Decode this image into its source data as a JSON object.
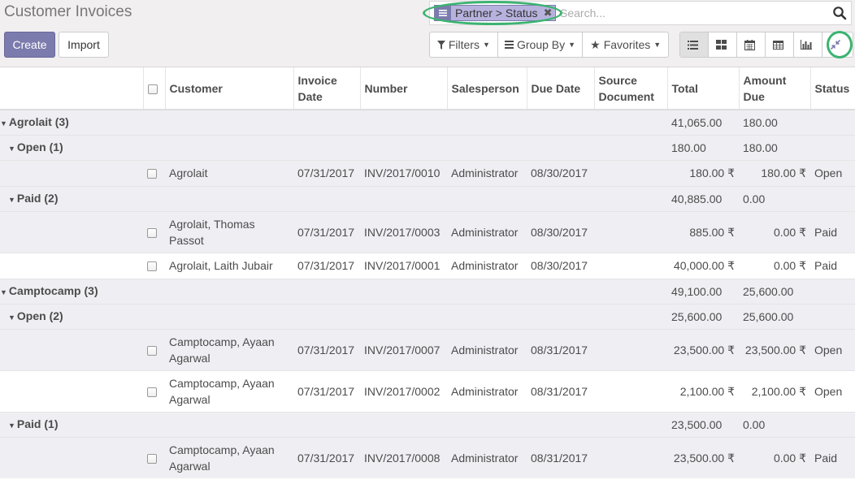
{
  "header": {
    "title": "Customer Invoices"
  },
  "search": {
    "facet_label": "Partner > Status",
    "facet_remove": "✖",
    "placeholder": "Search..."
  },
  "buttons": {
    "create": "Create",
    "import": "Import"
  },
  "filters": {
    "filters": "Filters",
    "group_by": "Group By",
    "favorites": "Favorites"
  },
  "views": [
    "list",
    "kanban",
    "calendar",
    "pivot",
    "graph",
    "collapse"
  ],
  "colors": {
    "primary": "#7c7bad",
    "facet_bg": "#b7b2dd",
    "group_bg": "#eeeef3",
    "highlight": "#3cb371"
  },
  "table": {
    "columns": {
      "customer": "Customer",
      "invoice_date_1": "Invoice",
      "invoice_date_2": "Date",
      "number": "Number",
      "salesperson": "Salesperson",
      "due_date": "Due Date",
      "source_1": "Source",
      "source_2": "Document",
      "total": "Total",
      "amount_due_1": "Amount",
      "amount_due_2": "Due",
      "status": "Status"
    },
    "groups": [
      {
        "label": "Agrolait (3)",
        "total": "41,065.00",
        "due": "180.00"
      },
      {
        "label": "Open (1)",
        "total": "180.00",
        "due": "180.00"
      },
      {
        "label": "Paid (2)",
        "total": "40,885.00",
        "due": "0.00"
      },
      {
        "label": "Camptocamp (3)",
        "total": "49,100.00",
        "due": "25,600.00"
      },
      {
        "label": "Open (2)",
        "total": "25,600.00",
        "due": "25,600.00"
      },
      {
        "label": "Paid (1)",
        "total": "23,500.00",
        "due": "0.00"
      }
    ],
    "rows": [
      {
        "customer": "Agrolait",
        "date": "07/31/2017",
        "number": "INV/2017/0010",
        "salesperson": "Administrator",
        "due_date": "08/30/2017",
        "total": "180.00 ₹",
        "due": "180.00 ₹",
        "status": "Open"
      },
      {
        "customer_1": "Agrolait, Thomas",
        "customer_2": "Passot",
        "date": "07/31/2017",
        "number": "INV/2017/0003",
        "salesperson": "Administrator",
        "due_date": "08/30/2017",
        "total": "885.00 ₹",
        "due": "0.00 ₹",
        "status": "Paid"
      },
      {
        "customer": "Agrolait, Laith Jubair",
        "date": "07/31/2017",
        "number": "INV/2017/0001",
        "salesperson": "Administrator",
        "due_date": "08/30/2017",
        "total": "40,000.00 ₹",
        "due": "0.00 ₹",
        "status": "Paid"
      },
      {
        "customer_1": "Camptocamp, Ayaan",
        "customer_2": "Agarwal",
        "date": "07/31/2017",
        "number": "INV/2017/0007",
        "salesperson": "Administrator",
        "due_date": "08/31/2017",
        "total": "23,500.00 ₹",
        "due": "23,500.00 ₹",
        "status": "Open"
      },
      {
        "customer_1": "Camptocamp, Ayaan",
        "customer_2": "Agarwal",
        "date": "07/31/2017",
        "number": "INV/2017/0002",
        "salesperson": "Administrator",
        "due_date": "08/31/2017",
        "total": "2,100.00 ₹",
        "due": "2,100.00 ₹",
        "status": "Open"
      },
      {
        "customer_1": "Camptocamp, Ayaan",
        "customer_2": "Agarwal",
        "date": "07/31/2017",
        "number": "INV/2017/0008",
        "salesperson": "Administrator",
        "due_date": "08/31/2017",
        "total": "23,500.00 ₹",
        "due": "0.00 ₹",
        "status": "Paid"
      }
    ]
  }
}
